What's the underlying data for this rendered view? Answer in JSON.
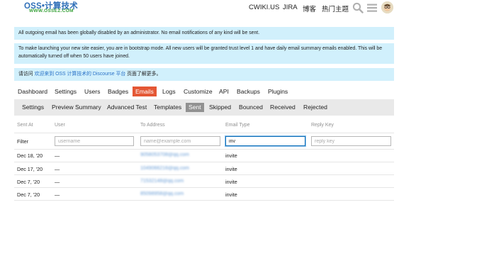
{
  "header": {
    "logo_text": "OSS•计算技术",
    "logo_subtext": "WWW.OSSEZ.COM",
    "nav": [
      "CWIKI.US",
      "JIRA",
      "博客",
      "热门主题"
    ]
  },
  "banners": {
    "email_disabled": "All outgoing email has been globally disabled by an administrator. No email notifications of any kind will be sent.",
    "bootstrap_mode": "To make launching your new site easier, you are in bootstrap mode. All new users will be granted trust level 1 and have daily email summary emails enabled. This will be automatically turned off when 50 users have joined.",
    "welcome_prefix": "请访问",
    "welcome_link": "欢迎来到 OSS 计算技术的 Discourse 平台",
    "welcome_suffix": "页面了解更多。"
  },
  "admin_tabs": [
    "Dashboard",
    "Settings",
    "Users",
    "Badges",
    "Emails",
    "Logs",
    "Customize",
    "API",
    "Backups",
    "Plugins"
  ],
  "email_tabs": [
    "Settings",
    "Preview Summary",
    "Advanced Test",
    "Templates",
    "Sent",
    "Skipped",
    "Bounced",
    "Received",
    "Rejected"
  ],
  "table": {
    "headers": [
      "Sent At",
      "User",
      "To Address",
      "Email Type",
      "Reply Key"
    ],
    "filter_label": "Filter",
    "filters": {
      "user_placeholder": "username",
      "address_placeholder": "name@example.com",
      "type_value": "inv",
      "reply_placeholder": "reply key"
    },
    "rows": [
      {
        "sent_at": "Dec 18, '20",
        "user": "—",
        "address": "9058053708@qq.com",
        "type": "invite"
      },
      {
        "sent_at": "Dec 17, '20",
        "user": "—",
        "address": "1049066216@qq.com",
        "type": "invite"
      },
      {
        "sent_at": "Dec 7, '20",
        "user": "—",
        "address": "71532148@qq.com",
        "type": "invite"
      },
      {
        "sent_at": "Dec 7, '20",
        "user": "—",
        "address": "85098958@qq.com",
        "type": "invite"
      }
    ]
  },
  "colors": {
    "brand_blue": "#2f6fb8",
    "brand_green": "#3aa23a",
    "banner_bg": "#d1f0fc",
    "active_tab": "#e45735",
    "active_subtab": "#919191",
    "link": "#2a72c7"
  },
  "icons": [
    "search-icon",
    "menu-icon",
    "avatar-icon"
  ]
}
